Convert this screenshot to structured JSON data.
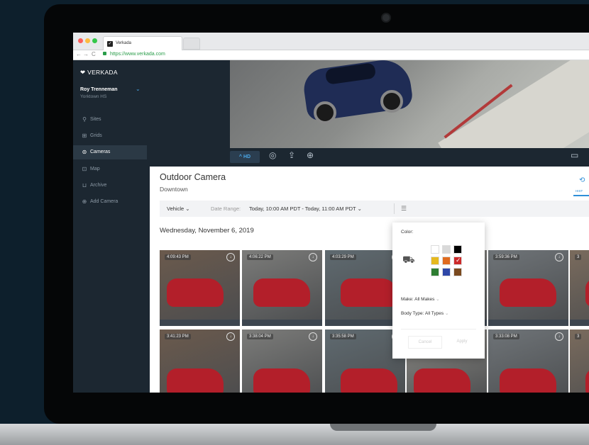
{
  "browser": {
    "tab_title": "Verkada",
    "url": "https://www.verkada.com"
  },
  "sidebar": {
    "brand": "VERKADA",
    "user_name": "Roy Trenneman",
    "user_org": "Yorktown HS",
    "items": [
      {
        "label": "Sites",
        "icon": "pin-icon",
        "active": false
      },
      {
        "label": "Grids",
        "icon": "grid-icon",
        "active": false
      },
      {
        "label": "Cameras",
        "icon": "camera-icon",
        "active": true
      },
      {
        "label": "Map",
        "icon": "map-icon",
        "active": false
      },
      {
        "label": "Archive",
        "icon": "archive-icon",
        "active": false
      },
      {
        "label": "Add Camera",
        "icon": "plus-circle-icon",
        "active": false
      }
    ]
  },
  "video": {
    "hd_label": "HD"
  },
  "camera": {
    "title": "Outdoor Camera",
    "location": "Downtown",
    "history_label": "HIST"
  },
  "filters": {
    "vehicle_label": "Vehicle",
    "date_range_label": "Date Range:",
    "date_range_value": "Today, 10:00 AM PDT - Today, 11:00 AM PDT"
  },
  "date_heading": "Wednesday, November 6, 2019",
  "thumbnails": [
    {
      "time": "4:09:43 PM"
    },
    {
      "time": "4:06:22 PM"
    },
    {
      "time": "4:03:29 PM"
    },
    {
      "time": ""
    },
    {
      "time": "3:59:36 PM"
    },
    {
      "time": "3"
    },
    {
      "time": "3:41:23 PM"
    },
    {
      "time": "3:38:04 PM"
    },
    {
      "time": "3:35:58 PM"
    },
    {
      "time": ""
    },
    {
      "time": "3:33:08 PM"
    },
    {
      "time": "3"
    }
  ],
  "color_popup": {
    "color_label": "Color:",
    "make_label": "Make:",
    "make_value": "All Makes",
    "body_label": "Body Type:",
    "body_value": "All Types",
    "cancel_label": "Cancel",
    "apply_label": "Apply",
    "swatches": [
      "#ffffff",
      "#d9d9d9",
      "#000000",
      "#e6b91e",
      "#e06b1f",
      "#cc2a2a",
      "#2e7d32",
      "#2f47a8",
      "#7a4a1f"
    ],
    "selected_swatch": "#cc2a2a"
  }
}
